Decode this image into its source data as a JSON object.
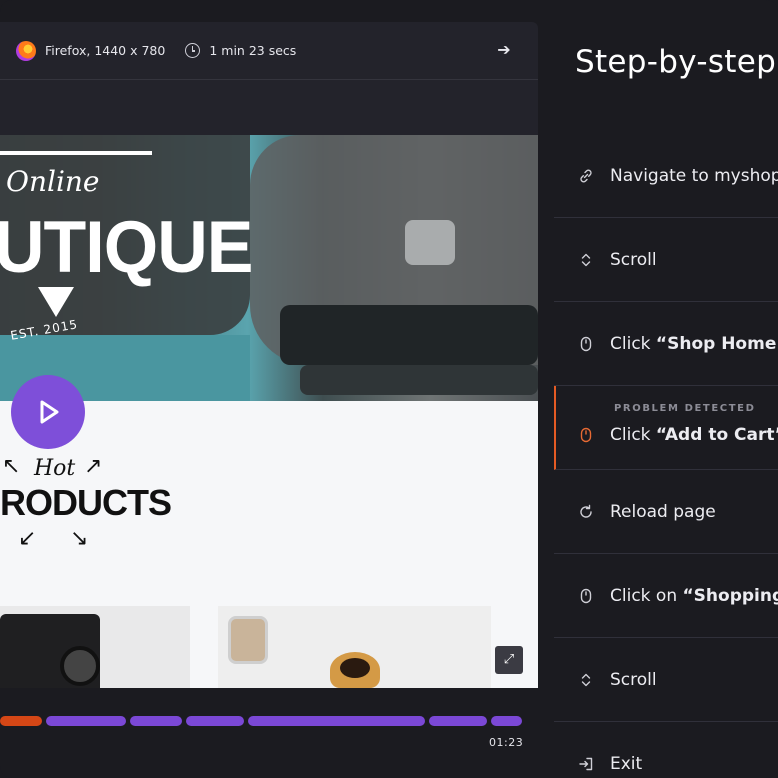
{
  "player": {
    "browser": "Firefox, 1440 x 780",
    "duration": "1 min 23 secs",
    "next_icon": "arrow-right-icon",
    "timestamp": "01:23"
  },
  "page_preview": {
    "logo_script": "Online",
    "logo_main": "UTIQUE",
    "logo_est": "EST. 2015",
    "hot": "Hot",
    "products": "RODUCTS"
  },
  "timeline": {
    "segments": [
      {
        "color": "#d54716"
      },
      {
        "color": "#7b48d6"
      },
      {
        "color": "#7b48d6"
      },
      {
        "color": "#7b48d6"
      },
      {
        "color": "#7b48d6"
      },
      {
        "color": "#7b48d6"
      },
      {
        "color": "#7b48d6"
      }
    ]
  },
  "steps": {
    "title": "Step-by-step",
    "problem_tag": "PROBLEM DETECTED",
    "items": [
      {
        "icon": "link-icon",
        "text": "Navigate to myshoppi",
        "bold": ""
      },
      {
        "icon": "scroll-icon",
        "text": "Scroll",
        "bold": ""
      },
      {
        "icon": "mouse-icon",
        "text": "Click ",
        "bold": "“Shop Home Go"
      },
      {
        "icon": "mouse-icon",
        "text": "Click ",
        "bold": "“Add to Cart”"
      },
      {
        "icon": "reload-icon",
        "text": "Reload page",
        "bold": ""
      },
      {
        "icon": "mouse-icon",
        "text": "Click on ",
        "bold": "“Shopping C"
      },
      {
        "icon": "scroll-icon",
        "text": "Scroll",
        "bold": ""
      },
      {
        "icon": "exit-icon",
        "text": "Exit",
        "bold": ""
      }
    ]
  },
  "colors": {
    "accent": "#7b48d6",
    "problem": "#e55b24",
    "background": "#1b1b20"
  }
}
